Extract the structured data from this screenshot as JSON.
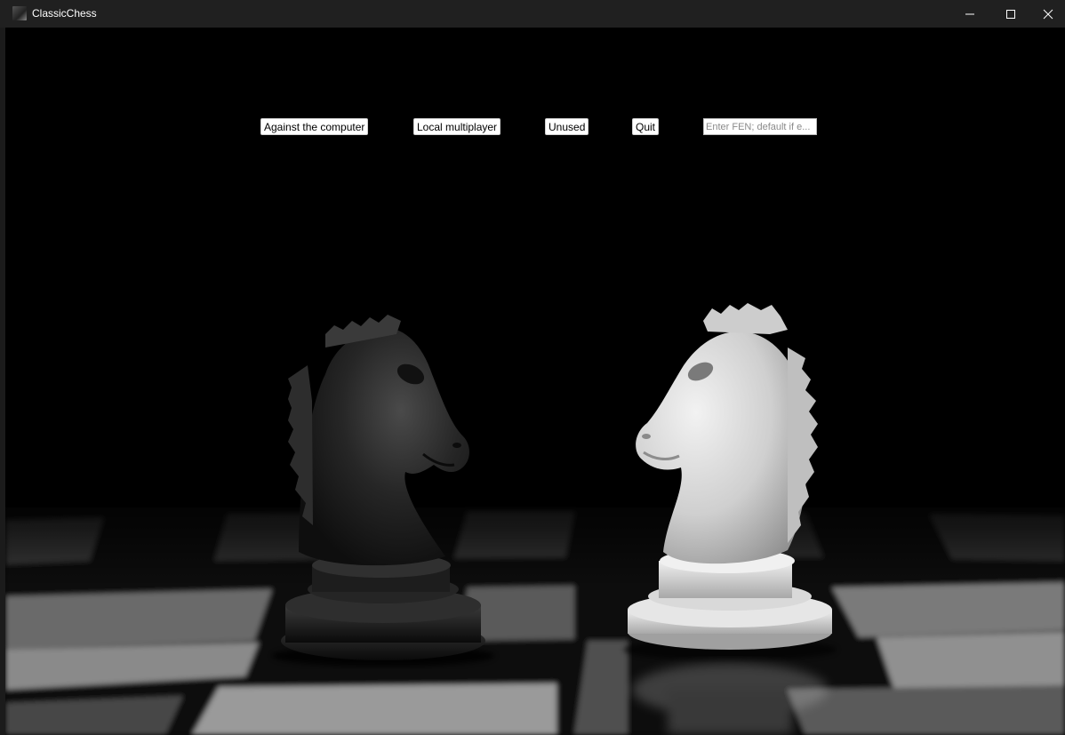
{
  "window": {
    "title": "ClassicChess",
    "app_icon": "knight-icon"
  },
  "controls": {
    "minimize_icon": "minimize-icon",
    "maximize_icon": "maximize-icon",
    "close_icon": "close-icon"
  },
  "menu": {
    "against_computer": "Against the computer",
    "local_multiplayer": "Local multiplayer",
    "unused": "Unused",
    "quit": "Quit",
    "fen_placeholder": "Enter FEN; default if e..."
  },
  "background": {
    "description_icon": "chess-knights-background",
    "colors": {
      "sky": "#000000",
      "dark_piece": "#1c1c1c",
      "light_piece": "#d8d8d8"
    }
  }
}
